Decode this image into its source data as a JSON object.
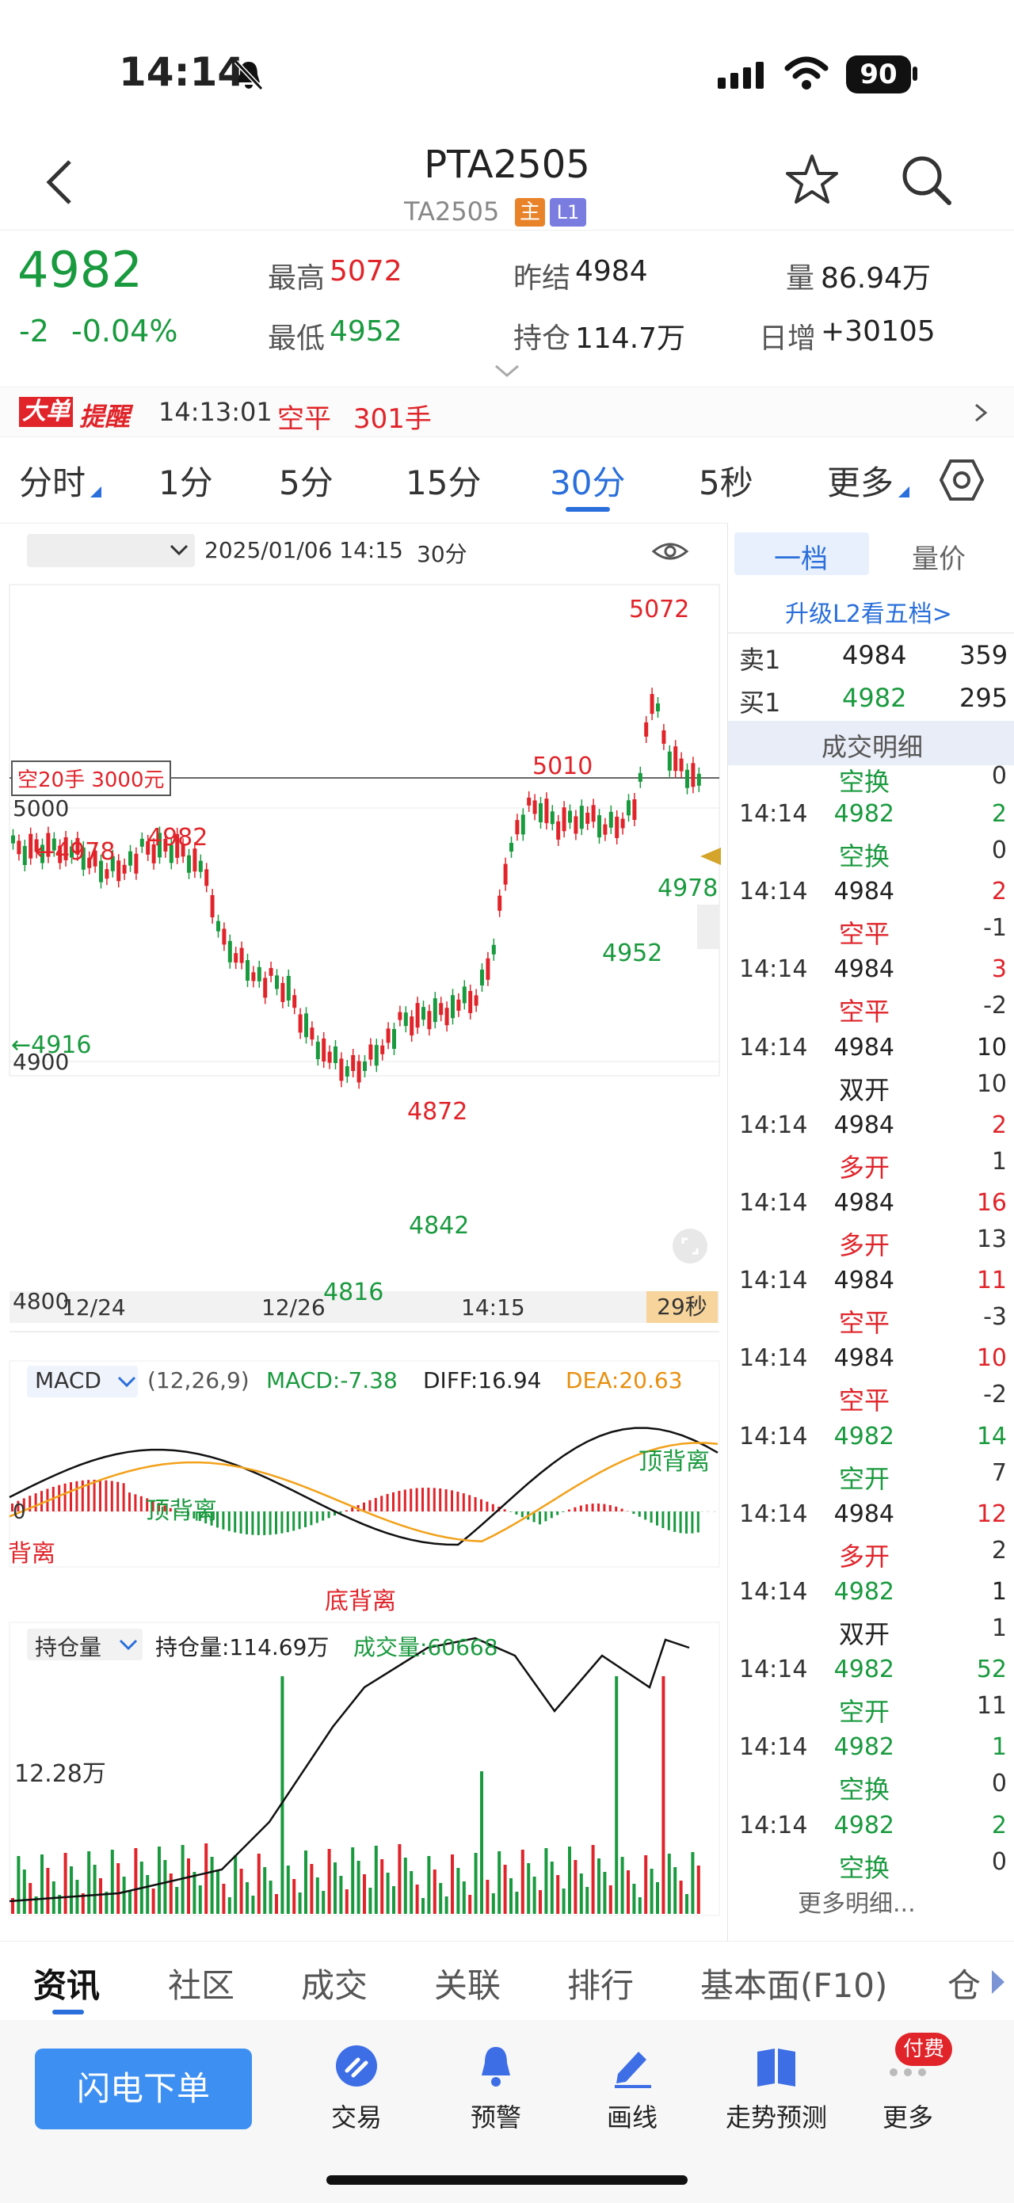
{
  "status_bar": {
    "time": "14:14",
    "battery": "90"
  },
  "header": {
    "title": "PTA2505",
    "subtitle": "TA2505",
    "badge_main": "主",
    "badge_level": "L1"
  },
  "quote": {
    "price": "4982",
    "change": "-2",
    "change_pct": "-0.04%",
    "high_label": "最高",
    "high": "5072",
    "low_label": "最低",
    "low": "4952",
    "prev_settle_label": "昨结",
    "prev_settle": "4984",
    "open_interest_label": "持仓",
    "open_interest": "114.7万",
    "volume_label": "量",
    "volume": "86.94万",
    "daily_inc_label": "日增",
    "daily_inc": "+30105"
  },
  "alert": {
    "tag_a": "大单",
    "tag_b": "提醒",
    "time": "14:13:01",
    "type": "空平",
    "qty": "301手"
  },
  "period_tabs": [
    "分时",
    "1分",
    "5分",
    "15分",
    "30分",
    "5秒",
    "更多"
  ],
  "active_period": "30分",
  "chart_header": {
    "datetime": "2025/01/06 14:15",
    "period": "30分"
  },
  "chart_labels": {
    "y_5000": "5000",
    "y_4900": "4900",
    "y_4800": "4800",
    "hi_5072": "5072",
    "p_5010": "5010",
    "p_4978_left": "←4978",
    "p_4982": "4982",
    "p_4916": "←4916",
    "p_4872": "4872",
    "p_4842": "4842",
    "p_4816": "4816",
    "p_4952": "4952",
    "p_4978_right": "4978",
    "order_tag": "空20手 3000元",
    "x_1": "12/24",
    "x_2": "12/26",
    "x_3": "14:15",
    "countdown": "29秒"
  },
  "macd": {
    "selector": "MACD",
    "params": "(12,26,9)",
    "macd": "MACD:-7.38",
    "diff": "DIFF:16.94",
    "dea": "DEA:20.63",
    "top_div_1": "顶背离",
    "top_div_2": "顶背离",
    "bottom_div": "底背离",
    "left_div": "背离",
    "zero": "0"
  },
  "oi_panel": {
    "selector": "持仓量",
    "oi": "持仓量:114.69万",
    "vol": "成交量:60668",
    "scale": "12.28万"
  },
  "right_panel": {
    "tab1": "一档",
    "tab2": "量价",
    "upgrade": "升级L2看五档>",
    "ask_label": "卖1",
    "ask_price": "4984",
    "ask_qty": "359",
    "bid_label": "买1",
    "bid_price": "4982",
    "bid_qty": "295",
    "trades_title": "成交明细",
    "top_partial_type": "空换",
    "top_partial_val": "0",
    "trades": [
      {
        "time": "14:14",
        "price": "4982",
        "qty": "2",
        "type": "空换",
        "oi": "0",
        "pc": "green",
        "tc": "green"
      },
      {
        "time": "14:14",
        "price": "4984",
        "qty": "2",
        "type": "空平",
        "oi": "-1",
        "pc": "dark",
        "tc": "red"
      },
      {
        "time": "14:14",
        "price": "4984",
        "qty": "3",
        "type": "空平",
        "oi": "-2",
        "pc": "dark",
        "tc": "red"
      },
      {
        "time": "14:14",
        "price": "4984",
        "qty": "10",
        "type": "双开",
        "oi": "10",
        "pc": "dark",
        "tc": "dark"
      },
      {
        "time": "14:14",
        "price": "4984",
        "qty": "2",
        "type": "多开",
        "oi": "1",
        "pc": "dark",
        "tc": "red"
      },
      {
        "time": "14:14",
        "price": "4984",
        "qty": "16",
        "type": "多开",
        "oi": "13",
        "pc": "dark",
        "tc": "red"
      },
      {
        "time": "14:14",
        "price": "4984",
        "qty": "11",
        "type": "空平",
        "oi": "-3",
        "pc": "dark",
        "tc": "red"
      },
      {
        "time": "14:14",
        "price": "4984",
        "qty": "10",
        "type": "空平",
        "oi": "-2",
        "pc": "dark",
        "tc": "red"
      },
      {
        "time": "14:14",
        "price": "4982",
        "qty": "14",
        "type": "空开",
        "oi": "7",
        "pc": "green",
        "tc": "green"
      },
      {
        "time": "14:14",
        "price": "4984",
        "qty": "12",
        "type": "多开",
        "oi": "2",
        "pc": "dark",
        "tc": "red"
      },
      {
        "time": "14:14",
        "price": "4982",
        "qty": "1",
        "type": "双开",
        "oi": "1",
        "pc": "green",
        "tc": "dark"
      },
      {
        "time": "14:14",
        "price": "4982",
        "qty": "52",
        "type": "空开",
        "oi": "11",
        "pc": "green",
        "tc": "green"
      },
      {
        "time": "14:14",
        "price": "4982",
        "qty": "1",
        "type": "空换",
        "oi": "0",
        "pc": "green",
        "tc": "green"
      },
      {
        "time": "14:14",
        "price": "4982",
        "qty": "2",
        "type": "空换",
        "oi": "0",
        "pc": "green",
        "tc": "green"
      }
    ],
    "more": "更多明细..."
  },
  "info_tabs": [
    "资讯",
    "社区",
    "成交",
    "关联",
    "排行",
    "基本面(F10)",
    "仓"
  ],
  "toolbar": {
    "order_button": "闪电下单",
    "trade": "交易",
    "alert": "预警",
    "draw": "画线",
    "forecast": "走势预测",
    "more": "更多",
    "paid_badge": "付费"
  },
  "colors": {
    "up": "#e0242a",
    "down": "#1a9a3f",
    "accent": "#2a6fdb"
  }
}
